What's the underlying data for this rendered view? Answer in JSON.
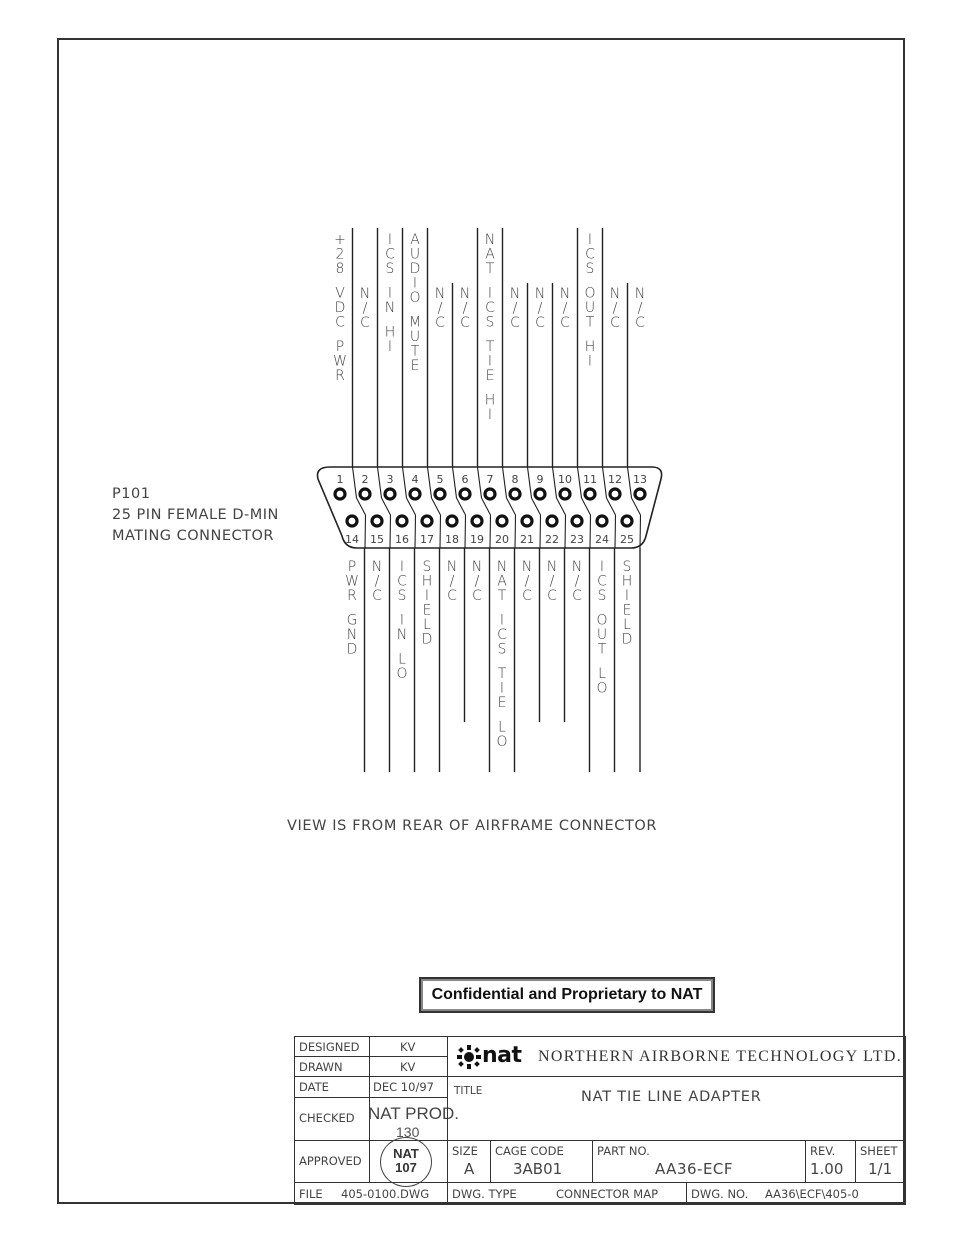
{
  "connector": {
    "ref": "P101",
    "description_line1": "25 PIN FEMALE D-MIN",
    "description_line2": "MATING CONNECTOR",
    "top_row": [
      {
        "pin": "1",
        "label": "+28 VDC PWR",
        "wired": true
      },
      {
        "pin": "2",
        "label": "N/C",
        "wired": false
      },
      {
        "pin": "3",
        "label": "ICS IN HI",
        "wired": true
      },
      {
        "pin": "4",
        "label": "AUDIO MUTE",
        "wired": true
      },
      {
        "pin": "5",
        "label": "N/C",
        "wired": false
      },
      {
        "pin": "6",
        "label": "N/C",
        "wired": false
      },
      {
        "pin": "7",
        "label": "NAT ICS TIE HI",
        "wired": true
      },
      {
        "pin": "8",
        "label": "N/C",
        "wired": false
      },
      {
        "pin": "9",
        "label": "N/C",
        "wired": false
      },
      {
        "pin": "10",
        "label": "N/C",
        "wired": false
      },
      {
        "pin": "11",
        "label": "ICS OUT HI",
        "wired": true
      },
      {
        "pin": "12",
        "label": "N/C",
        "wired": false
      },
      {
        "pin": "13",
        "label": "N/C",
        "wired": false
      }
    ],
    "bottom_row": [
      {
        "pin": "14",
        "label": "PWR GND",
        "wired": true
      },
      {
        "pin": "15",
        "label": "N/C",
        "wired": false
      },
      {
        "pin": "16",
        "label": "ICS IN LO",
        "wired": true
      },
      {
        "pin": "17",
        "label": "SHIELD",
        "wired": true
      },
      {
        "pin": "18",
        "label": "N/C",
        "wired": false
      },
      {
        "pin": "19",
        "label": "N/C",
        "wired": false
      },
      {
        "pin": "20",
        "label": "NAT ICS TIE LO",
        "wired": true
      },
      {
        "pin": "21",
        "label": "N/C",
        "wired": false
      },
      {
        "pin": "22",
        "label": "N/C",
        "wired": false
      },
      {
        "pin": "23",
        "label": "N/C",
        "wired": false
      },
      {
        "pin": "24",
        "label": "ICS OUT LO",
        "wired": true
      },
      {
        "pin": "25",
        "label": "SHIELD",
        "wired": true
      }
    ]
  },
  "view_note": "VIEW IS FROM REAR OF AIRFRAME CONNECTOR",
  "confidential_notice": "Confidential and Proprietary to NAT",
  "title_block": {
    "designed_label": "DESIGNED",
    "designed_value": "KV",
    "drawn_label": "DRAWN",
    "drawn_value": "KV",
    "date_label": "DATE",
    "date_value": "DEC 10/97",
    "checked_label": "CHECKED",
    "checked_value": "NAT PROD.",
    "checked_stamp_number": "130",
    "approved_label": "APPROVED",
    "approved_stamp_line1": "NAT",
    "approved_stamp_line2": "107",
    "company_logo": "nat",
    "company_name": "NORTHERN AIRBORNE TECHNOLOGY LTD.",
    "title_label": "TITLE",
    "title_value": "NAT TIE LINE ADAPTER",
    "size_label": "SIZE",
    "size_value": "A",
    "cage_label": "CAGE CODE",
    "cage_value": "3AB01",
    "part_label": "PART NO.",
    "part_value": "AA36-ECF",
    "rev_label": "REV.",
    "rev_value": "1.00",
    "sheet_label": "SHEET",
    "sheet_value": "1/1",
    "file_label": "FILE",
    "file_value": "405-0100.DWG",
    "dwg_type_label": "DWG. TYPE",
    "dwg_type_value": "CONNECTOR MAP",
    "dwg_no_label": "DWG. NO.",
    "dwg_no_value": "AA36\\ECF\\405-0"
  }
}
